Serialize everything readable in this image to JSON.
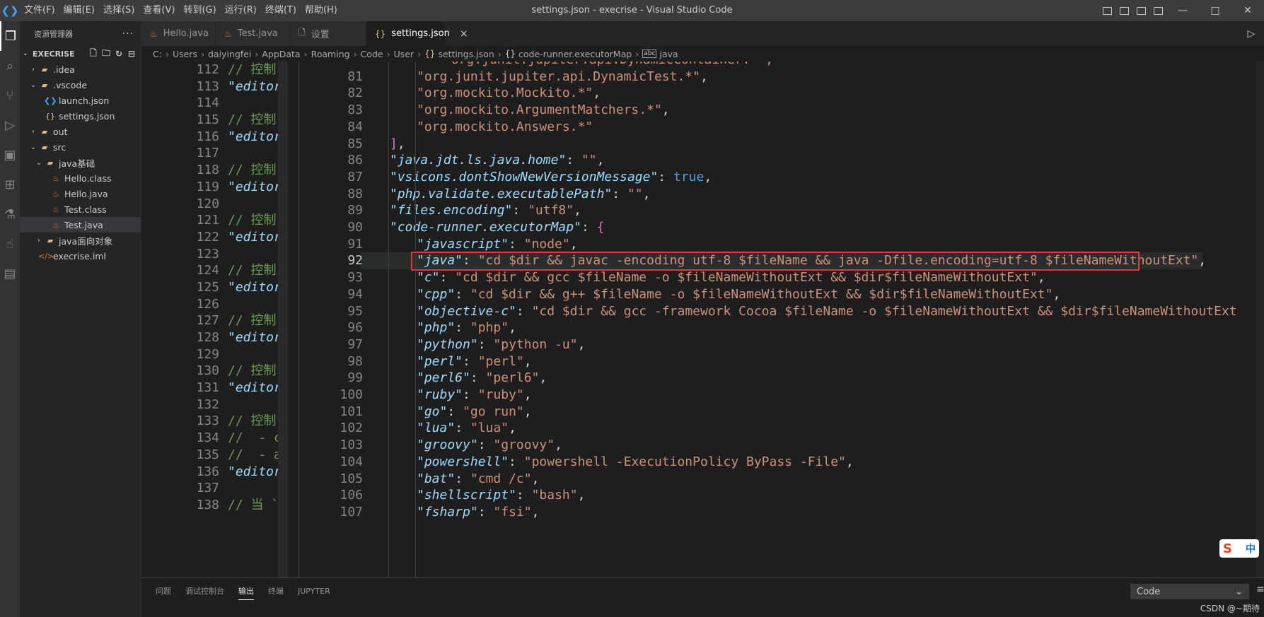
{
  "titlebar": {
    "app_logo": "vscode-logo",
    "title": "settings.json - execrise - Visual Studio Code",
    "menu": [
      "文件(F)",
      "编辑(E)",
      "选择(S)",
      "查看(V)",
      "转到(G)",
      "运行(R)",
      "终端(T)",
      "帮助(H)"
    ],
    "window_buttons": [
      "—",
      "□",
      "✕"
    ]
  },
  "activitybar": {
    "icons": [
      "files-icon",
      "search-icon",
      "source-control-icon",
      "run-debug-icon",
      "remote-explorer-icon",
      "extensions-icon",
      "testing-icon",
      "touch-icon",
      "docker-icon"
    ]
  },
  "sidebar": {
    "title": "资源管理器",
    "more": "···",
    "section": "EXECRISE",
    "tree": [
      {
        "label": ".idea",
        "depth": 1,
        "type": "folder",
        "expanded": false
      },
      {
        "label": ".vscode",
        "depth": 1,
        "type": "folder",
        "expanded": true
      },
      {
        "label": "launch.json",
        "depth": 2,
        "type": "vscode-json"
      },
      {
        "label": "settings.json",
        "depth": 2,
        "type": "json"
      },
      {
        "label": "out",
        "depth": 1,
        "type": "folder",
        "expanded": false
      },
      {
        "label": "src",
        "depth": 1,
        "type": "folder",
        "expanded": true
      },
      {
        "label": "java基础",
        "depth": 2,
        "type": "folder",
        "expanded": true
      },
      {
        "label": "Hello.class",
        "depth": 3,
        "type": "java"
      },
      {
        "label": "Hello.java",
        "depth": 3,
        "type": "java"
      },
      {
        "label": "Test.class",
        "depth": 3,
        "type": "java"
      },
      {
        "label": "Test.java",
        "depth": 3,
        "type": "java",
        "selected": true
      },
      {
        "label": "java面向对象",
        "depth": 2,
        "type": "folder",
        "expanded": false
      },
      {
        "label": "execrise.iml",
        "depth": 1,
        "type": "xml"
      }
    ]
  },
  "tabs": [
    {
      "label": "Hello.java",
      "icon": "java-icon",
      "active": false
    },
    {
      "label": "Test.java",
      "icon": "java-icon",
      "active": false
    },
    {
      "label": "设置",
      "icon": "settings-file-icon",
      "active": false
    },
    {
      "label": "settings.json",
      "icon": "json-icon",
      "active": true,
      "close": "×"
    }
  ],
  "breadcrumb": [
    "C:",
    "Users",
    "daiyingfei",
    "AppData",
    "Roaming",
    "Code",
    "User",
    "settings.json",
    "code-runner.executorMap",
    "java"
  ],
  "left_editor": {
    "lines": [
      {
        "n": "112",
        "t": "// 控制",
        "k": "comment"
      },
      {
        "n": "113",
        "t": "\"editor",
        "k": "key"
      },
      {
        "n": "114",
        "t": "",
        "k": ""
      },
      {
        "n": "115",
        "t": "// 控制",
        "k": "comment"
      },
      {
        "n": "116",
        "t": "\"editor",
        "k": "key"
      },
      {
        "n": "117",
        "t": "",
        "k": ""
      },
      {
        "n": "118",
        "t": "// 控制",
        "k": "comment"
      },
      {
        "n": "119",
        "t": "\"editor",
        "k": "key"
      },
      {
        "n": "120",
        "t": "",
        "k": ""
      },
      {
        "n": "121",
        "t": "// 控制",
        "k": "comment"
      },
      {
        "n": "122",
        "t": "\"editor",
        "k": "key"
      },
      {
        "n": "123",
        "t": "",
        "k": ""
      },
      {
        "n": "124",
        "t": "// 控制",
        "k": "comment"
      },
      {
        "n": "125",
        "t": "\"editor",
        "k": "key"
      },
      {
        "n": "126",
        "t": "",
        "k": ""
      },
      {
        "n": "127",
        "t": "// 控制",
        "k": "comment"
      },
      {
        "n": "128",
        "t": "\"editor",
        "k": "key"
      },
      {
        "n": "129",
        "t": "",
        "k": ""
      },
      {
        "n": "130",
        "t": "// 控制",
        "k": "comment"
      },
      {
        "n": "131",
        "t": "\"editor",
        "k": "key"
      },
      {
        "n": "132",
        "t": "",
        "k": ""
      },
      {
        "n": "133",
        "t": "// 控制",
        "k": "comment"
      },
      {
        "n": "134",
        "t": "//  - c",
        "k": "comment"
      },
      {
        "n": "135",
        "t": "//  - a",
        "k": "comment"
      },
      {
        "n": "136",
        "t": "\"editor",
        "k": "key"
      },
      {
        "n": "137",
        "t": "",
        "k": ""
      },
      {
        "n": "138",
        "t": "// 当 `",
        "k": "comment"
      }
    ]
  },
  "right_editor": {
    "top_partial": "\"org.junit.jupiter.api.DynamicContainer.*\",",
    "lines": [
      {
        "n": "81",
        "indent": 2,
        "parts": [
          [
            "str",
            "\"org.junit.jupiter.api.DynamicTest.*\""
          ],
          [
            "punc",
            ","
          ]
        ]
      },
      {
        "n": "82",
        "indent": 2,
        "parts": [
          [
            "str",
            "\"org.mockito.Mockito.*\""
          ],
          [
            "punc",
            ","
          ]
        ]
      },
      {
        "n": "83",
        "indent": 2,
        "parts": [
          [
            "str",
            "\"org.mockito.ArgumentMatchers.*\""
          ],
          [
            "punc",
            ","
          ]
        ]
      },
      {
        "n": "84",
        "indent": 2,
        "parts": [
          [
            "str",
            "\"org.mockito.Answers.*\""
          ]
        ]
      },
      {
        "n": "85",
        "indent": 1,
        "parts": [
          [
            "bracket",
            "]"
          ],
          [
            "punc",
            ","
          ]
        ]
      },
      {
        "n": "86",
        "indent": 1,
        "parts": [
          [
            "key",
            "\"java.jdt.ls.java.home\""
          ],
          [
            "punc",
            ": "
          ],
          [
            "str",
            "\"\""
          ],
          [
            "punc",
            ","
          ]
        ]
      },
      {
        "n": "87",
        "indent": 1,
        "parts": [
          [
            "key",
            "\"vsicons.dontShowNewVersionMessage\""
          ],
          [
            "punc",
            ": "
          ],
          [
            "bool",
            "true"
          ],
          [
            "punc",
            ","
          ]
        ]
      },
      {
        "n": "88",
        "indent": 1,
        "parts": [
          [
            "key",
            "\"php.validate.executablePath\""
          ],
          [
            "punc",
            ": "
          ],
          [
            "str",
            "\"\""
          ],
          [
            "punc",
            ","
          ]
        ]
      },
      {
        "n": "89",
        "indent": 1,
        "parts": [
          [
            "key",
            "\"files.encoding\""
          ],
          [
            "punc",
            ": "
          ],
          [
            "str",
            "\"utf8\""
          ],
          [
            "punc",
            ","
          ]
        ]
      },
      {
        "n": "90",
        "indent": 1,
        "parts": [
          [
            "key",
            "\"code-runner.executorMap\""
          ],
          [
            "punc",
            ": "
          ],
          [
            "brace",
            "{"
          ]
        ]
      },
      {
        "n": "91",
        "indent": 2,
        "parts": [
          [
            "key",
            "\"javascript\""
          ],
          [
            "punc",
            ": "
          ],
          [
            "str",
            "\"node\""
          ],
          [
            "punc",
            ","
          ]
        ]
      },
      {
        "n": "92",
        "indent": 2,
        "current": true,
        "parts": [
          [
            "key",
            "\"java\""
          ],
          [
            "punc",
            ": "
          ],
          [
            "str",
            "\"cd $dir && javac -encoding utf-8 $fileName && java -Dfile.encoding=utf-8 $fileNameWithoutExt\""
          ],
          [
            "punc",
            ","
          ]
        ]
      },
      {
        "n": "93",
        "indent": 2,
        "parts": [
          [
            "key",
            "\"c\""
          ],
          [
            "punc",
            ": "
          ],
          [
            "str",
            "\"cd $dir && gcc $fileName -o $fileNameWithoutExt && $dir$fileNameWithoutExt\""
          ],
          [
            "punc",
            ","
          ]
        ]
      },
      {
        "n": "94",
        "indent": 2,
        "parts": [
          [
            "key",
            "\"cpp\""
          ],
          [
            "punc",
            ": "
          ],
          [
            "str",
            "\"cd $dir && g++ $fileName -o $fileNameWithoutExt && $dir$fileNameWithoutExt\""
          ],
          [
            "punc",
            ","
          ]
        ]
      },
      {
        "n": "95",
        "indent": 2,
        "parts": [
          [
            "key",
            "\"objective-c\""
          ],
          [
            "punc",
            ": "
          ],
          [
            "str",
            "\"cd $dir && gcc -framework Cocoa $fileName -o $fileNameWithoutExt && $dir$fileNameWithoutExt"
          ]
        ]
      },
      {
        "n": "96",
        "indent": 2,
        "parts": [
          [
            "key",
            "\"php\""
          ],
          [
            "punc",
            ": "
          ],
          [
            "str",
            "\"php\""
          ],
          [
            "punc",
            ","
          ]
        ]
      },
      {
        "n": "97",
        "indent": 2,
        "parts": [
          [
            "key",
            "\"python\""
          ],
          [
            "punc",
            ": "
          ],
          [
            "str",
            "\"python -u\""
          ],
          [
            "punc",
            ","
          ]
        ]
      },
      {
        "n": "98",
        "indent": 2,
        "parts": [
          [
            "key",
            "\"perl\""
          ],
          [
            "punc",
            ": "
          ],
          [
            "str",
            "\"perl\""
          ],
          [
            "punc",
            ","
          ]
        ]
      },
      {
        "n": "99",
        "indent": 2,
        "parts": [
          [
            "key",
            "\"perl6\""
          ],
          [
            "punc",
            ": "
          ],
          [
            "str",
            "\"perl6\""
          ],
          [
            "punc",
            ","
          ]
        ]
      },
      {
        "n": "100",
        "indent": 2,
        "parts": [
          [
            "key",
            "\"ruby\""
          ],
          [
            "punc",
            ": "
          ],
          [
            "str",
            "\"ruby\""
          ],
          [
            "punc",
            ","
          ]
        ]
      },
      {
        "n": "101",
        "indent": 2,
        "parts": [
          [
            "key",
            "\"go\""
          ],
          [
            "punc",
            ": "
          ],
          [
            "str",
            "\"go run\""
          ],
          [
            "punc",
            ","
          ]
        ]
      },
      {
        "n": "102",
        "indent": 2,
        "parts": [
          [
            "key",
            "\"lua\""
          ],
          [
            "punc",
            ": "
          ],
          [
            "str",
            "\"lua\""
          ],
          [
            "punc",
            ","
          ]
        ]
      },
      {
        "n": "103",
        "indent": 2,
        "parts": [
          [
            "key",
            "\"groovy\""
          ],
          [
            "punc",
            ": "
          ],
          [
            "str",
            "\"groovy\""
          ],
          [
            "punc",
            ","
          ]
        ]
      },
      {
        "n": "104",
        "indent": 2,
        "parts": [
          [
            "key",
            "\"powershell\""
          ],
          [
            "punc",
            ": "
          ],
          [
            "str",
            "\"powershell -ExecutionPolicy ByPass -File\""
          ],
          [
            "punc",
            ","
          ]
        ]
      },
      {
        "n": "105",
        "indent": 2,
        "parts": [
          [
            "key",
            "\"bat\""
          ],
          [
            "punc",
            ": "
          ],
          [
            "str",
            "\"cmd /c\""
          ],
          [
            "punc",
            ","
          ]
        ]
      },
      {
        "n": "106",
        "indent": 2,
        "parts": [
          [
            "key",
            "\"shellscript\""
          ],
          [
            "punc",
            ": "
          ],
          [
            "str",
            "\"bash\""
          ],
          [
            "punc",
            ","
          ]
        ]
      },
      {
        "n": "107",
        "indent": 2,
        "parts": [
          [
            "key",
            "\"fsharp\""
          ],
          [
            "punc",
            ": "
          ],
          [
            "str",
            "\"fsi\""
          ],
          [
            "punc",
            ","
          ]
        ]
      }
    ]
  },
  "panel": {
    "tabs": [
      "问题",
      "调试控制台",
      "输出",
      "终端",
      "JUPYTER"
    ],
    "active_tab": "输出",
    "output_channel": "Code",
    "watermark": "CSDN @~期待"
  },
  "ime": {
    "brand": "S",
    "lang": "中"
  },
  "colors": {
    "highlight_box": "#e03a3a",
    "string": "#ce9178",
    "key": "#9cdcfe",
    "comment": "#6a9955",
    "bool": "#569cd6",
    "bracket": "#da70d6"
  }
}
